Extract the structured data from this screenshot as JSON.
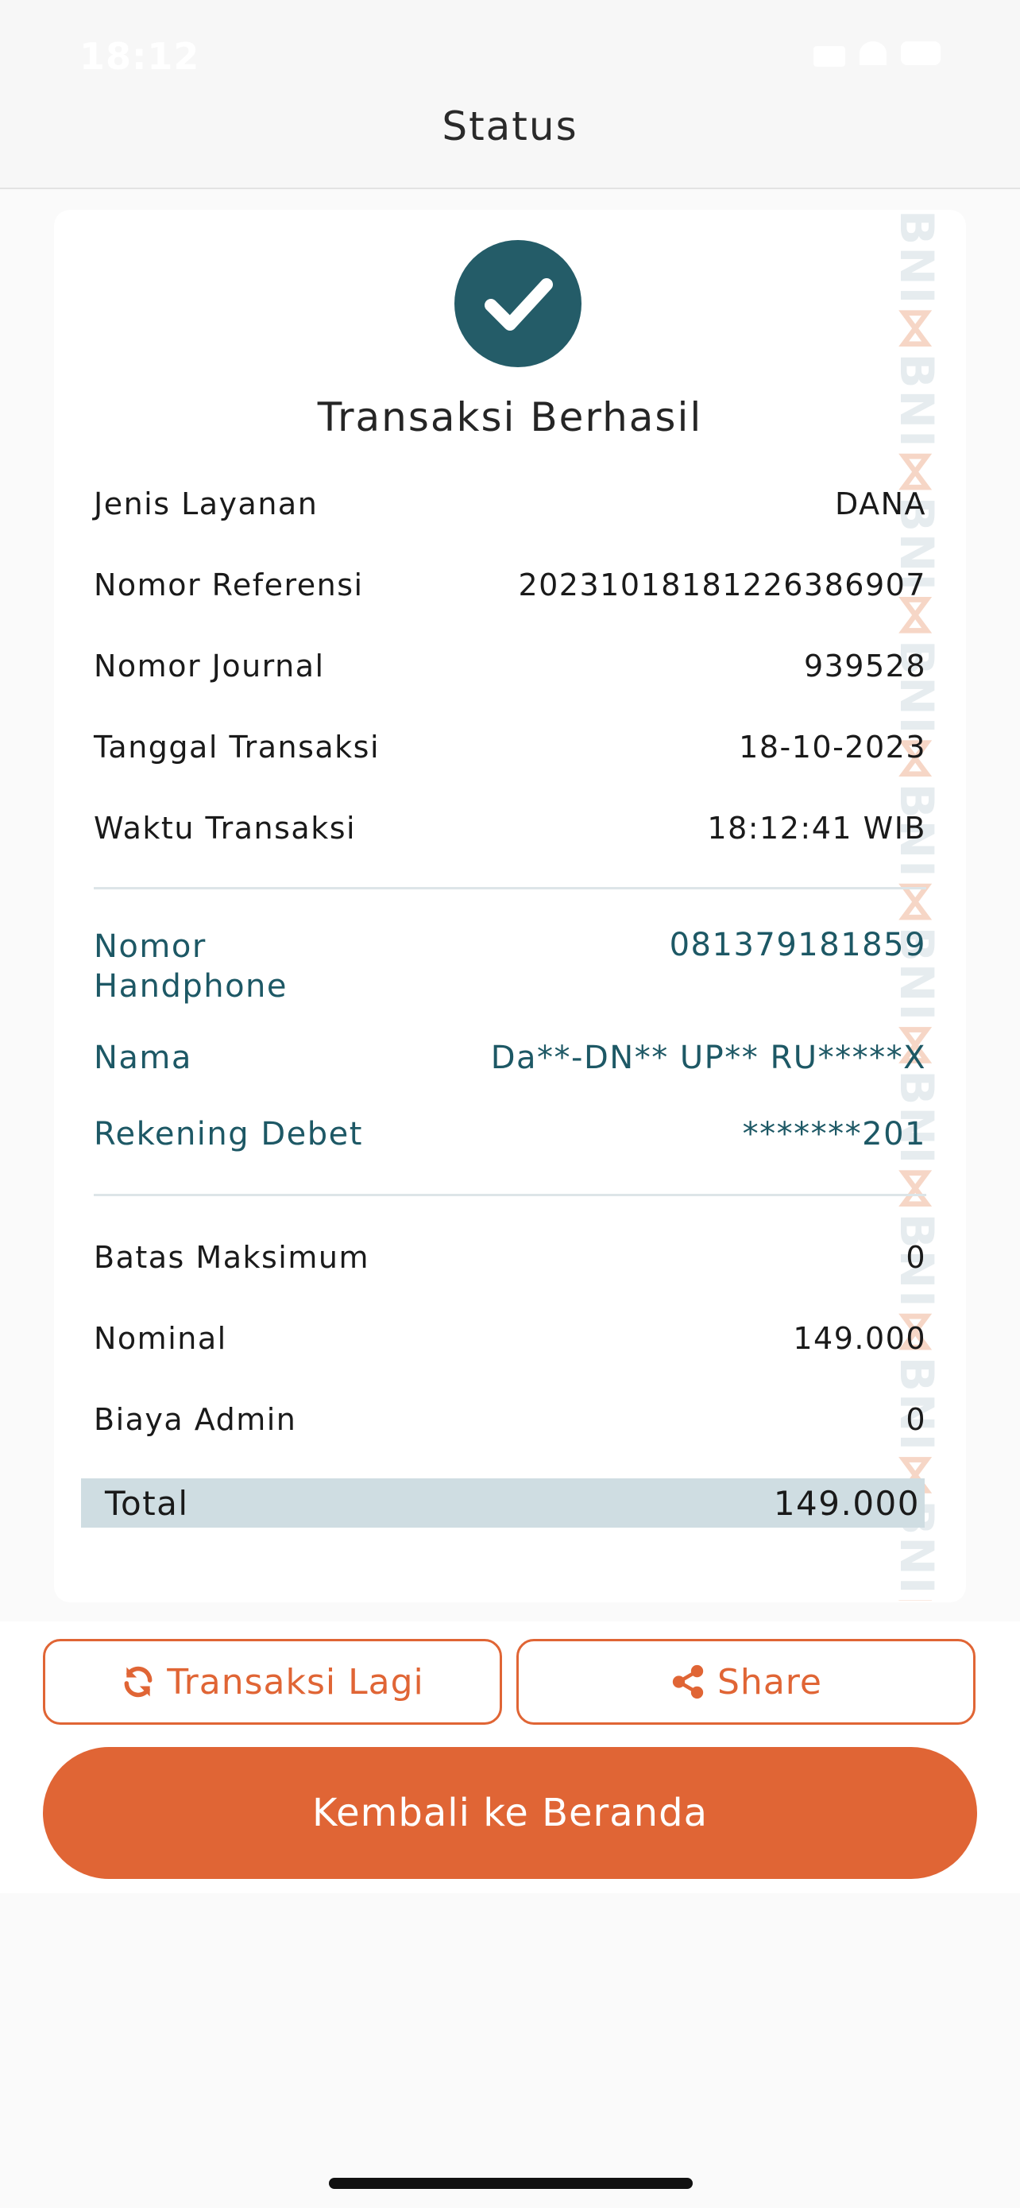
{
  "status_bar": {
    "time": "18:12"
  },
  "header": {
    "title": "Status"
  },
  "receipt": {
    "title": "Transaksi Berhasil",
    "watermark": "BNI",
    "details": [
      {
        "label": "Jenis Layanan",
        "value": "DANA"
      },
      {
        "label": "Nomor Referensi",
        "value": "20231018181226386907"
      },
      {
        "label": "Nomor Journal",
        "value": "939528"
      },
      {
        "label": "Tanggal Transaksi",
        "value": "18-10-2023"
      },
      {
        "label": "Waktu Transaksi",
        "value": "18:12:41 WIB"
      }
    ],
    "account": [
      {
        "label": "Nomor Handphone",
        "value": "081379181859"
      },
      {
        "label": "Nama",
        "value": "Da**-DN** UP** RU*****X"
      },
      {
        "label": "Rekening Debet",
        "value": "*******201"
      }
    ],
    "amounts": [
      {
        "label": "Batas Maksimum",
        "value": "0"
      },
      {
        "label": "Nominal",
        "value": "149.000"
      },
      {
        "label": "Biaya Admin",
        "value": "0"
      }
    ],
    "total": {
      "label": "Total",
      "value": "149.000"
    }
  },
  "actions": {
    "again": "Transaksi Lagi",
    "share": "Share",
    "home": "Kembali ke Beranda"
  },
  "colors": {
    "primary": "#e06535",
    "teal": "#245c68",
    "total_bg": "#cfdde2"
  }
}
